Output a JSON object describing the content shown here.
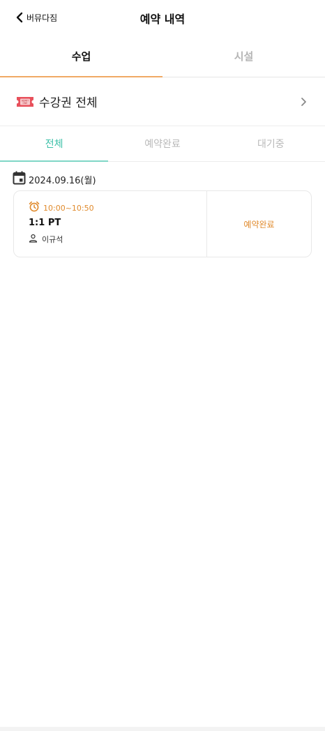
{
  "header": {
    "back_label": "버뮤다짐",
    "title": "예약 내역"
  },
  "primary_tabs": [
    {
      "label": "수업",
      "active": true
    },
    {
      "label": "시설",
      "active": false
    }
  ],
  "ticket_filter": {
    "label": "수강권 전체",
    "icon": "ticket-icon",
    "icon_text_1": "ADMIT",
    "icon_text_2": "ONE"
  },
  "status_tabs": [
    {
      "label": "전체",
      "active": true
    },
    {
      "label": "예약완료",
      "active": false
    },
    {
      "label": "대기중",
      "active": false
    }
  ],
  "reservations": {
    "date": "2024.09.16(월)",
    "items": [
      {
        "time": "10:00~10:50",
        "class_name": "1:1 PT",
        "instructor": "이규석",
        "status": "예약완료"
      }
    ]
  },
  "colors": {
    "accent_orange": "#f0a965",
    "status_orange": "#e08a2c",
    "accent_teal": "#3cc0a8",
    "inactive_gray": "#b5b5b5"
  }
}
